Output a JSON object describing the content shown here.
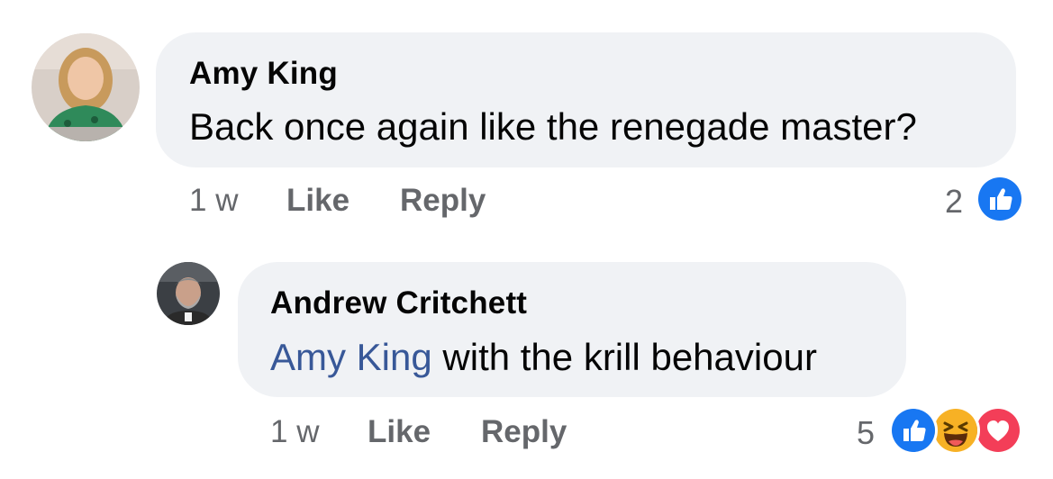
{
  "comments": [
    {
      "author": "Amy King",
      "text": "Back once again like the renegade master?",
      "time": "1 w",
      "like_label": "Like",
      "reply_label": "Reply",
      "reaction_count": "2",
      "reactions": [
        "like-icon"
      ],
      "avatar": "profile-photo"
    }
  ],
  "replies": [
    {
      "author": "Andrew Critchett",
      "mention": "Amy King",
      "text": " with the krill behaviour",
      "time": "1 w",
      "like_label": "Like",
      "reply_label": "Reply",
      "reaction_count": "5",
      "reactions": [
        "like-icon",
        "haha-icon",
        "love-icon"
      ],
      "avatar": "profile-photo"
    }
  ],
  "colors": {
    "bubble": "#f0f2f5",
    "meta": "#65676b",
    "mention": "#385898",
    "like_blue": "#1877f2",
    "love_red": "#f33e58",
    "haha_yellow": "#f7b125"
  }
}
